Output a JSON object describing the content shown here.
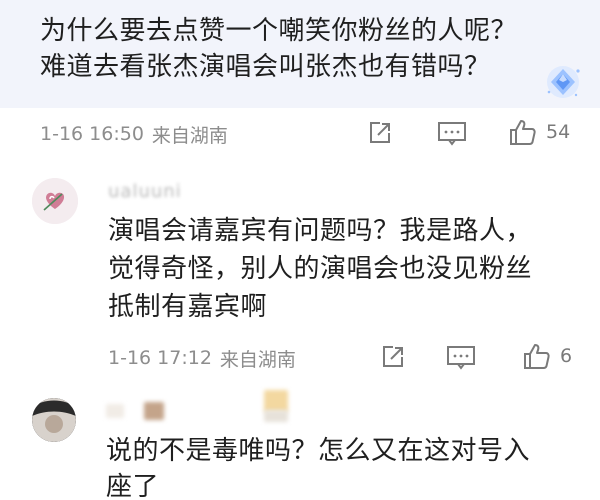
{
  "comments": [
    {
      "text_lines": [
        "为什么要去点赞一个嘲笑你粉丝的人呢？",
        "难道去看张杰演唱会叫张杰也有错吗？"
      ],
      "time": "1-16 16:50",
      "location": "来自湖南",
      "likes": "54",
      "badge_icon": "diamond-badge-icon"
    },
    {
      "username": "ualuuni",
      "text_lines": [
        "演唱会请嘉宾有问题吗？我是路人，",
        "觉得奇怪，别人的演唱会也没见粉丝",
        "抵制有嘉宾啊"
      ],
      "time": "1-16 17:12",
      "location": "来自湖南",
      "likes": "6"
    },
    {
      "text_lines": [
        "说的不是毒唯吗？怎么又在这对号入",
        "座了"
      ]
    }
  ],
  "colors": {
    "highlight_bg": "#f2f4fb",
    "meta_text": "#8d8d8d",
    "icon_gray": "#7a7a7a",
    "badge_blue": "#6fa8ff"
  },
  "icons": [
    "share-icon",
    "comment-icon",
    "like-icon",
    "diamond-badge-icon",
    "heart-avatar-icon"
  ]
}
